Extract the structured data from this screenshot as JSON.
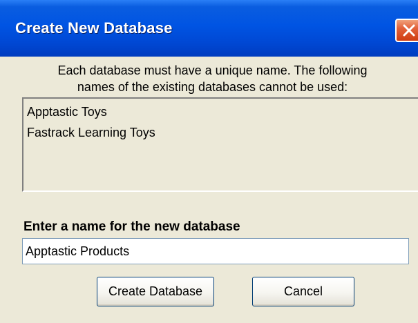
{
  "window": {
    "title": "Create New Database"
  },
  "dialog": {
    "intro_line1": "Each database must have a unique name. The following",
    "intro_line2": "names of the existing databases cannot be used:",
    "existing_databases": [
      "Apptastic Toys",
      "Fastrack Learning Toys"
    ],
    "name_label": "Enter a name for the new database",
    "name_value": "Apptastic Products",
    "create_label": "Create Database",
    "cancel_label": "Cancel"
  },
  "colors": {
    "titlebar": "#0054e3",
    "close_button": "#cf3d12",
    "dialog_background": "#ece9d8"
  },
  "icons": {
    "close": "close-icon"
  }
}
